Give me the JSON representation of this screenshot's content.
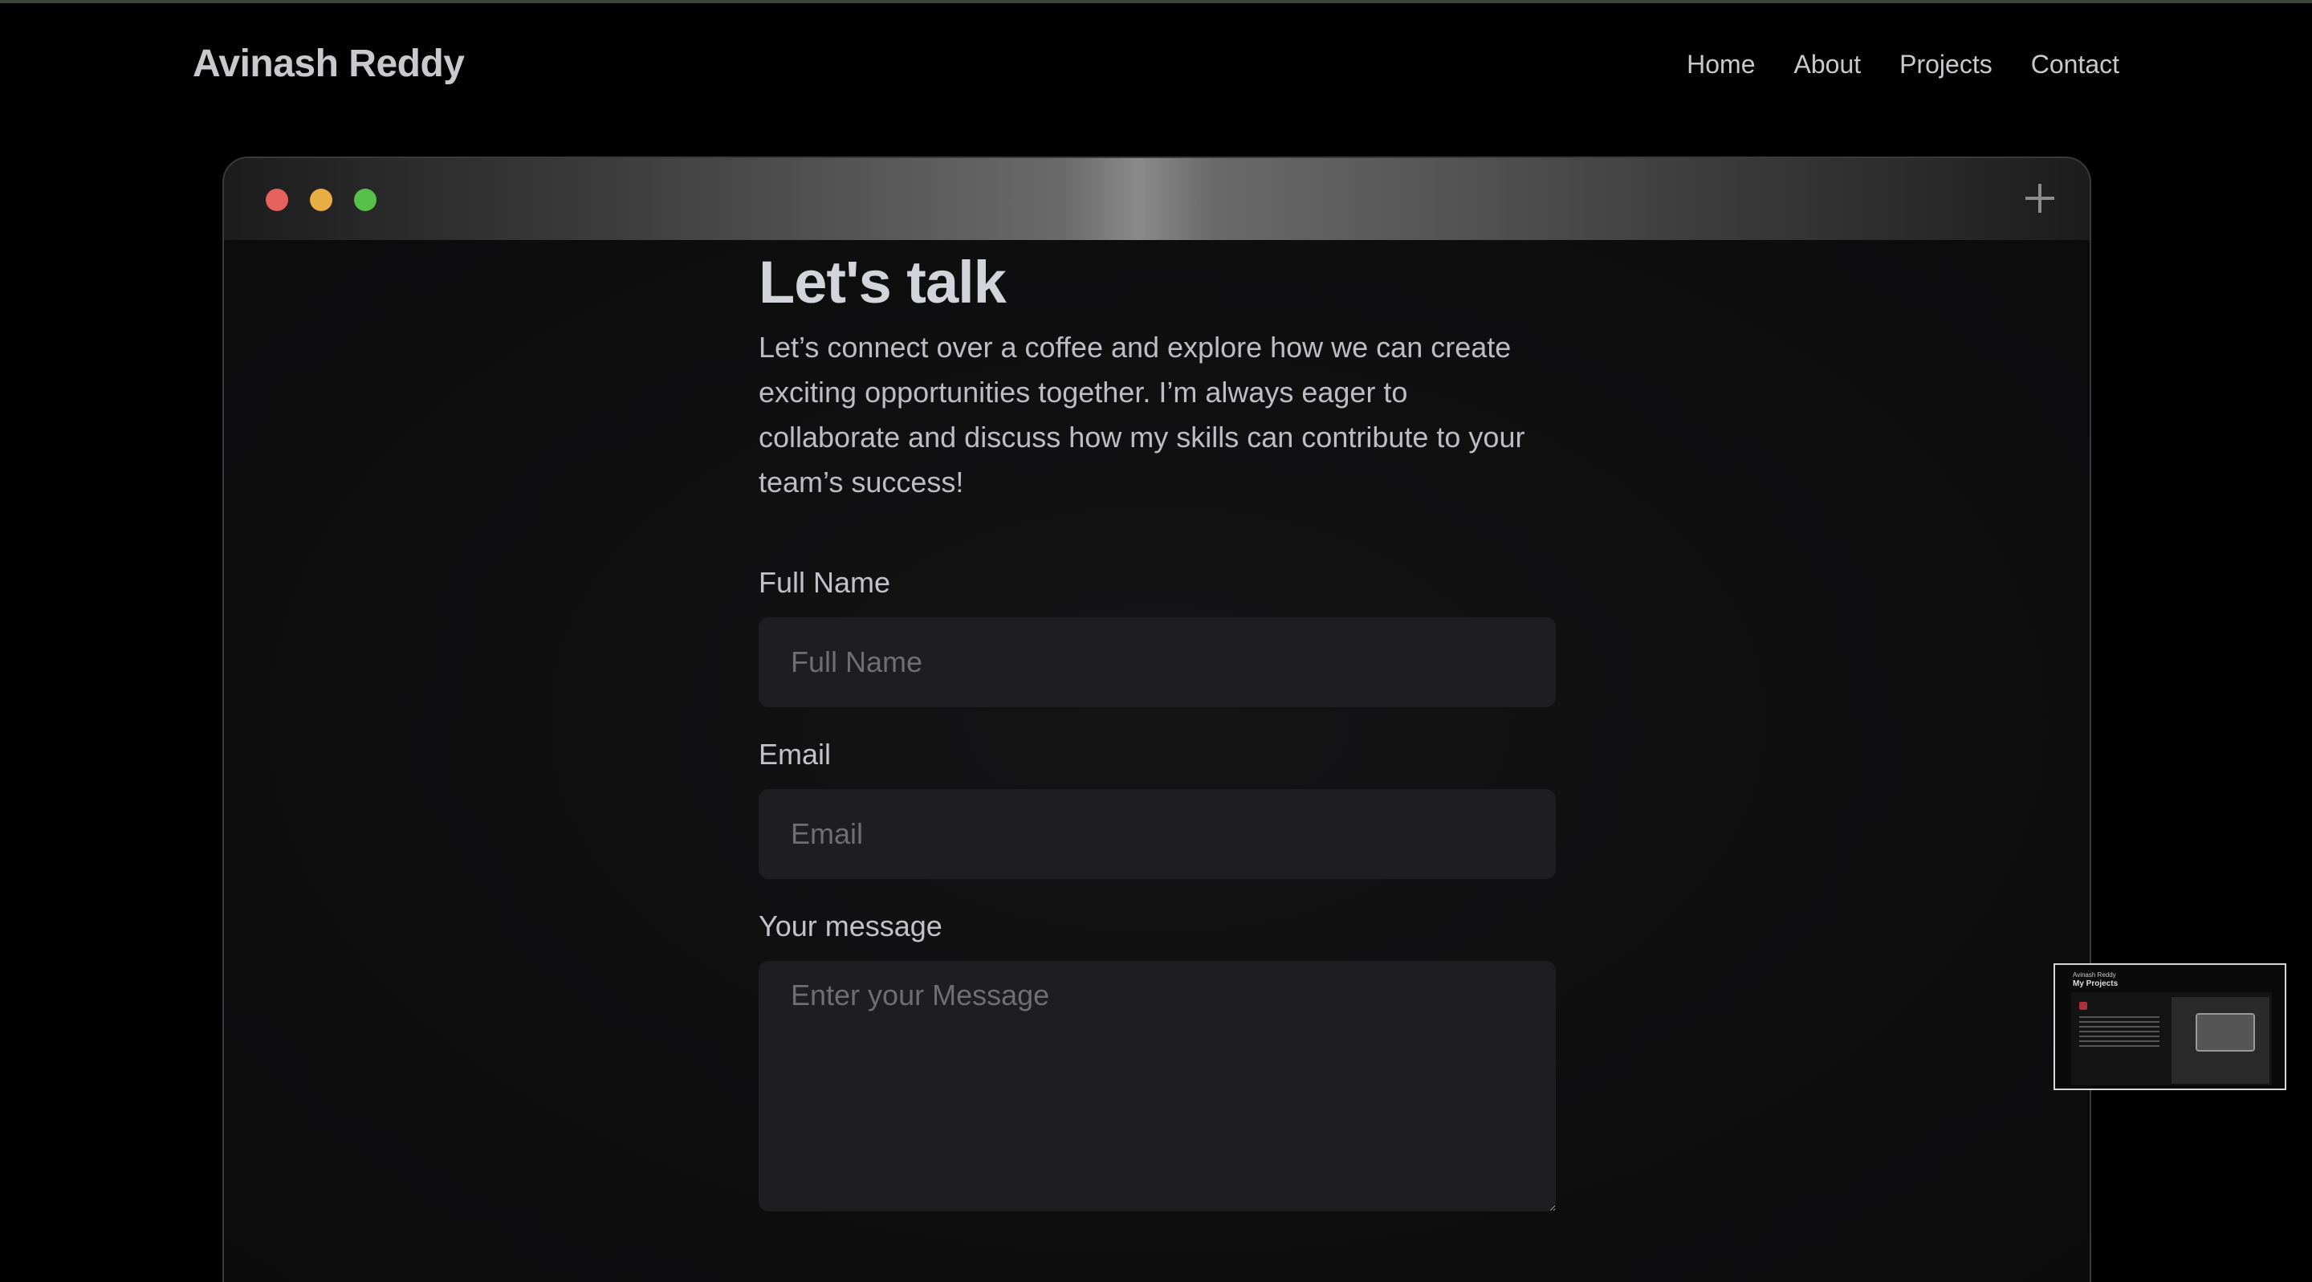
{
  "brand": "Avinash Reddy",
  "nav": {
    "items": [
      "Home",
      "About",
      "Projects",
      "Contact"
    ]
  },
  "window": {
    "controls": [
      "close",
      "minimize",
      "maximize"
    ],
    "control_colors": {
      "close": "#e5625d",
      "minimize": "#e9ae43",
      "maximize": "#57c04a"
    },
    "new_tab_icon": "plus-icon"
  },
  "contact": {
    "heading": "Let's talk",
    "intro": "Let’s connect over a coffee and explore how we can create exciting opportunities together. I’m always eager to collaborate and discuss how my skills can contribute to your team’s success!",
    "full_name": {
      "label": "Full Name",
      "placeholder": "Full Name"
    },
    "email": {
      "label": "Email",
      "placeholder": "Email"
    },
    "message": {
      "label": "Your message",
      "placeholder": "Enter your Message"
    }
  },
  "thumbnail": {
    "site_title": "Avinash Reddy",
    "heading": "My Projects"
  }
}
